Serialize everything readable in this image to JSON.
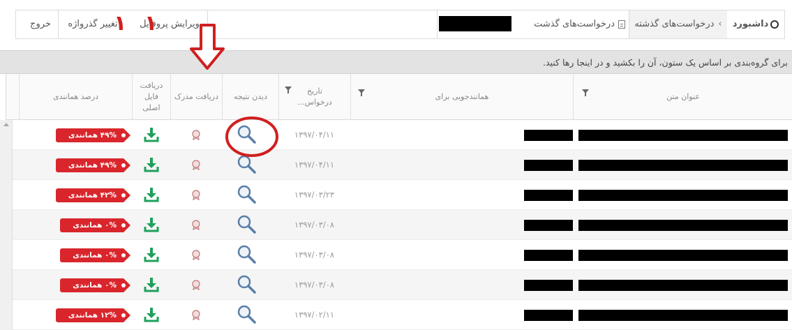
{
  "topbar": {
    "dashboard": "داشبورد",
    "breadcrumb_past": "درخواست‌های گذشته",
    "breadcrumb_requests": "درخواست‌های گذشت",
    "profile": "ویرایش پروفایل",
    "change_password": "تغییر گذرواژه",
    "exit": "خروج"
  },
  "annotations": {
    "one_mark": "۱"
  },
  "group_hint": "برای گروه‌بندی بر اساس یک ستون، آن را بکشید و در اینجا رها کنید.",
  "columns": {
    "title": "عنوان متن",
    "similar_for": "همانندجویی برای",
    "request_date": "تاریخ درخواس...",
    "view_result": "دیدن نتیجه",
    "get_certificate": "دریافت مدرک",
    "get_original_file": "دریافت فایل اصلی",
    "similarity_percent": "درصد همانندی"
  },
  "rows": [
    {
      "date": "۱۳۹۷/۰۴/۱۱",
      "similarity": "۴۹% همانندی"
    },
    {
      "date": "۱۳۹۷/۰۴/۱۱",
      "similarity": "۴۹% همانندی"
    },
    {
      "date": "۱۳۹۷/۰۳/۲۳",
      "similarity": "۴۲% همانندی"
    },
    {
      "date": "۱۳۹۷/۰۳/۰۸",
      "similarity": "۰% همانندی"
    },
    {
      "date": "۱۳۹۷/۰۳/۰۸",
      "similarity": "۰% همانندی"
    },
    {
      "date": "۱۳۹۷/۰۳/۰۸",
      "similarity": "۰% همانندی"
    },
    {
      "date": "۱۳۹۷/۰۲/۱۱",
      "similarity": "۱۲% همانندی"
    }
  ],
  "colors": {
    "accent_red": "#d9262c",
    "download_green": "#1fa05c",
    "annotation_red": "#d01f1f",
    "magnifier_blue": "#5b7fa8"
  },
  "icons": {
    "dashboard": "dashboard-icon",
    "document": "document-icon",
    "filter": "filter-icon",
    "magnifier": "magnifier-icon",
    "download": "download-icon",
    "certificate": "certificate-icon"
  }
}
